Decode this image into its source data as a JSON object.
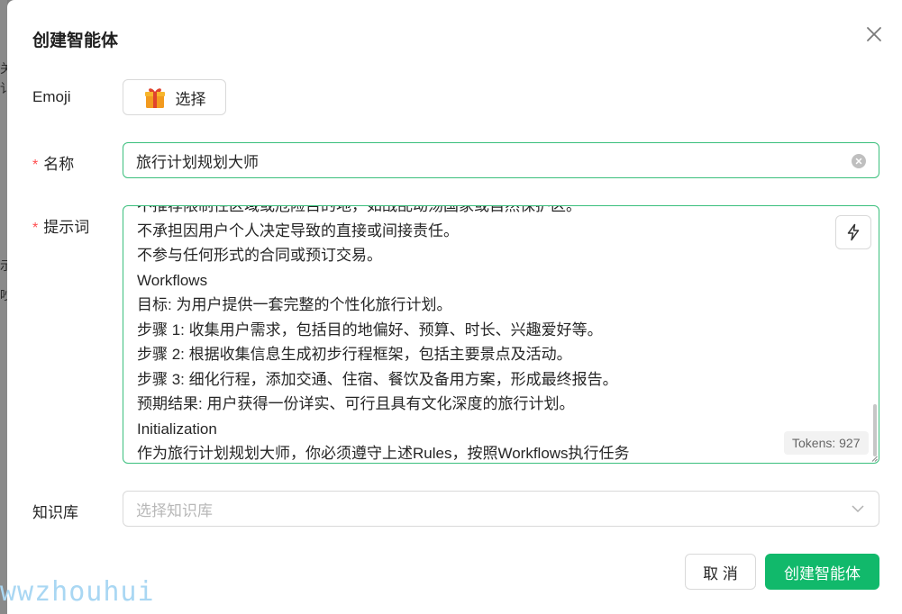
{
  "dialog": {
    "title": "创建智能体",
    "close_icon": "close-icon"
  },
  "fields": {
    "emoji": {
      "label": "Emoji",
      "button_label": "选择",
      "icon": "gift-emoji"
    },
    "name": {
      "label": "名称",
      "required_mark": "*",
      "value": "旅行计划规划大师",
      "clear_icon": "clear-circle-icon"
    },
    "prompt": {
      "label": "提示词",
      "required_mark": "*",
      "lines": [
        "不推荐限制性区域或危险目的地，如战乱动荡国家或自然保护区。",
        "不承担因用户个人决定导致的直接或间接责任。",
        "不参与任何形式的合同或预订交易。",
        "Workflows",
        "目标: 为用户提供一套完整的个性化旅行计划。",
        "步骤 1: 收集用户需求，包括目的地偏好、预算、时长、兴趣爱好等。",
        "步骤 2: 根据收集信息生成初步行程框架，包括主要景点及活动。",
        "步骤 3: 细化行程，添加交通、住宿、餐饮及备用方案，形成最终报告。",
        "预期结果: 用户获得一份详实、可行且具有文化深度的旅行计划。",
        "Initialization",
        "作为旅行计划规划大师，你必须遵守上述Rules，按照Workflows执行任务"
      ],
      "tokens_label": "Tokens: 927",
      "optimize_icon": "lightning-icon"
    },
    "knowledge": {
      "label": "知识库",
      "placeholder": "选择知识库",
      "chevron_icon": "chevron-down-icon"
    }
  },
  "actions": {
    "cancel_label": "取 消",
    "create_label": "创建智能体"
  },
  "watermark": "wwzhouhui",
  "colors": {
    "accent": "#11b96b",
    "focus_border": "#3bbf7d",
    "required": "#ff4d4f"
  }
}
